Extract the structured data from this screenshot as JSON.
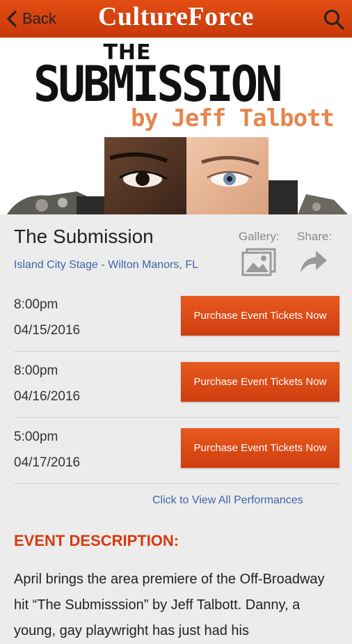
{
  "header": {
    "back_label": "Back",
    "brand_part1": "Culture",
    "brand_part2": "Force",
    "accent_color": "#d9420f"
  },
  "poster": {
    "the": "THE",
    "title": "SUBMISSION",
    "byline": "by Jeff Talbott"
  },
  "event": {
    "title": "The Submission",
    "venue": "Island City Stage - Wilton Manors, FL",
    "gallery_label": "Gallery:",
    "share_label": "Share:"
  },
  "performances": [
    {
      "time": "8:00pm",
      "date": "04/15/2016",
      "button": "Purchase Event Tickets Now"
    },
    {
      "time": "8:00pm",
      "date": "04/16/2016",
      "button": "Purchase Event Tickets Now"
    },
    {
      "time": "5:00pm",
      "date": "04/17/2016",
      "button": "Purchase Event Tickets Now"
    }
  ],
  "view_all_label": "Click to View All Performances",
  "description": {
    "heading": "EVENT DESCRIPTION:",
    "text": "April brings the area premiere of the Off-Broadway hit “The Submisssion” by Jeff Talbott. Danny, a young, gay playwright has just had his"
  },
  "icons": {
    "back": "chevron-left-icon",
    "search": "search-icon",
    "gallery": "image-gallery-icon",
    "share": "share-arrow-icon"
  }
}
